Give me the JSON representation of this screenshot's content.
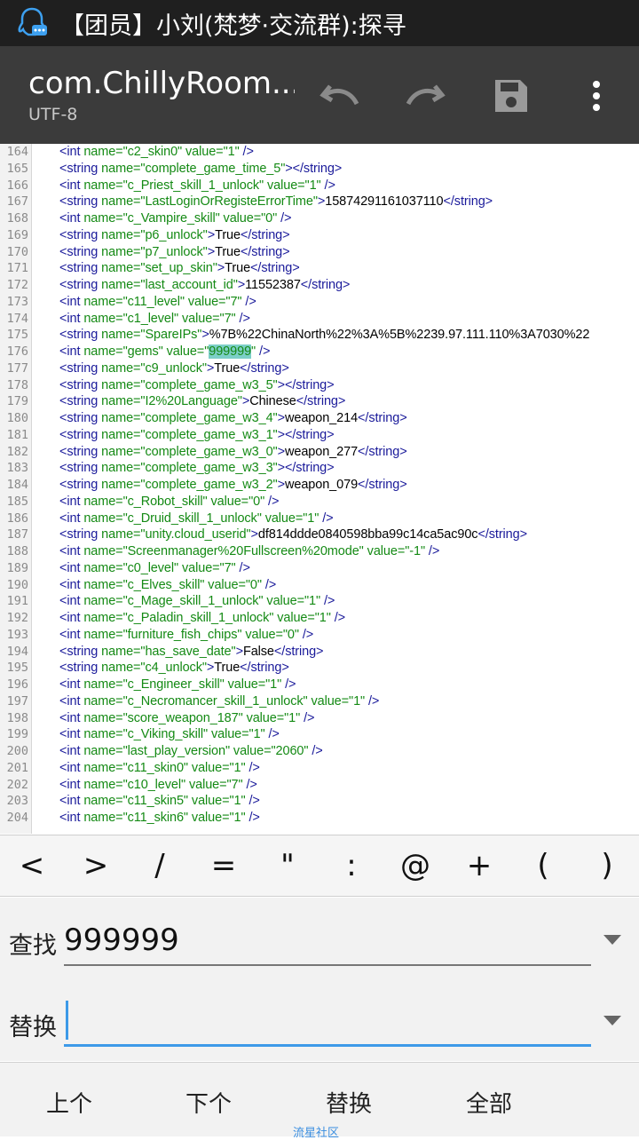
{
  "status_bar": {
    "notification": "【团员】小刘(梵梦·交流群):探寻",
    "app_icon": "qq-chat-icon"
  },
  "toolbar": {
    "title": "com.ChillyRoom....",
    "encoding": "UTF-8",
    "undo_icon": "undo-icon",
    "redo_icon": "redo-icon",
    "save_icon": "save-icon",
    "menu_icon": "more-vert-icon"
  },
  "editor": {
    "lines": [
      {
        "n": "164",
        "parts": [
          [
            "t",
            "<int "
          ],
          [
            "n",
            "name="
          ],
          [
            "v",
            "\"c2_skin0\""
          ],
          [
            "n",
            " value="
          ],
          [
            "v",
            "\"1\""
          ],
          [
            "t",
            " />"
          ]
        ]
      },
      {
        "n": "165",
        "parts": [
          [
            "t",
            "<string "
          ],
          [
            "n",
            "name="
          ],
          [
            "v",
            "\"complete_game_time_5\""
          ],
          [
            "t",
            "></string>"
          ]
        ]
      },
      {
        "n": "166",
        "parts": [
          [
            "t",
            "<int "
          ],
          [
            "n",
            "name="
          ],
          [
            "v",
            "\"c_Priest_skill_1_unlock\""
          ],
          [
            "n",
            " value="
          ],
          [
            "v",
            "\"1\""
          ],
          [
            "t",
            " />"
          ]
        ]
      },
      {
        "n": "167",
        "parts": [
          [
            "t",
            "<string "
          ],
          [
            "n",
            "name="
          ],
          [
            "v",
            "\"LastLoginOrRegisteErrorTime\""
          ],
          [
            "t",
            ">"
          ],
          [
            "x",
            "15874291161037110"
          ],
          [
            "t",
            "</string>"
          ]
        ]
      },
      {
        "n": "168",
        "parts": [
          [
            "t",
            "<int "
          ],
          [
            "n",
            "name="
          ],
          [
            "v",
            "\"c_Vampire_skill\""
          ],
          [
            "n",
            " value="
          ],
          [
            "v",
            "\"0\""
          ],
          [
            "t",
            " />"
          ]
        ]
      },
      {
        "n": "169",
        "parts": [
          [
            "t",
            "<string "
          ],
          [
            "n",
            "name="
          ],
          [
            "v",
            "\"p6_unlock\""
          ],
          [
            "t",
            ">"
          ],
          [
            "x",
            "True"
          ],
          [
            "t",
            "</string>"
          ]
        ]
      },
      {
        "n": "170",
        "parts": [
          [
            "t",
            "<string "
          ],
          [
            "n",
            "name="
          ],
          [
            "v",
            "\"p7_unlock\""
          ],
          [
            "t",
            ">"
          ],
          [
            "x",
            "True"
          ],
          [
            "t",
            "</string>"
          ]
        ]
      },
      {
        "n": "171",
        "parts": [
          [
            "t",
            "<string "
          ],
          [
            "n",
            "name="
          ],
          [
            "v",
            "\"set_up_skin\""
          ],
          [
            "t",
            ">"
          ],
          [
            "x",
            "True"
          ],
          [
            "t",
            "</string>"
          ]
        ]
      },
      {
        "n": "172",
        "parts": [
          [
            "t",
            "<string "
          ],
          [
            "n",
            "name="
          ],
          [
            "v",
            "\"last_account_id\""
          ],
          [
            "t",
            ">"
          ],
          [
            "x",
            "11552387"
          ],
          [
            "t",
            "</string>"
          ]
        ]
      },
      {
        "n": "173",
        "parts": [
          [
            "t",
            "<int "
          ],
          [
            "n",
            "name="
          ],
          [
            "v",
            "\"c11_level\""
          ],
          [
            "n",
            " value="
          ],
          [
            "v",
            "\"7\""
          ],
          [
            "t",
            " />"
          ]
        ]
      },
      {
        "n": "174",
        "parts": [
          [
            "t",
            "<int "
          ],
          [
            "n",
            "name="
          ],
          [
            "v",
            "\"c1_level\""
          ],
          [
            "n",
            " value="
          ],
          [
            "v",
            "\"7\""
          ],
          [
            "t",
            " />"
          ]
        ]
      },
      {
        "n": "175",
        "parts": [
          [
            "t",
            "<string "
          ],
          [
            "n",
            "name="
          ],
          [
            "v",
            "\"SpareIPs\""
          ],
          [
            "t",
            ">"
          ],
          [
            "x",
            "%7B%22ChinaNorth%22%3A%5B%2239.97.111.110%3A7030%22"
          ]
        ]
      },
      {
        "n": "176",
        "parts": [
          [
            "t",
            "<int "
          ],
          [
            "n",
            "name="
          ],
          [
            "v",
            "\"gems\""
          ],
          [
            "n",
            " value="
          ],
          [
            "v",
            "\""
          ],
          [
            "h",
            "999999"
          ],
          [
            "v",
            "\""
          ],
          [
            "t",
            " />"
          ]
        ]
      },
      {
        "n": "177",
        "parts": [
          [
            "t",
            "<string "
          ],
          [
            "n",
            "name="
          ],
          [
            "v",
            "\"c9_unlock\""
          ],
          [
            "t",
            ">"
          ],
          [
            "x",
            "True"
          ],
          [
            "t",
            "</string>"
          ]
        ]
      },
      {
        "n": "178",
        "parts": [
          [
            "t",
            "<string "
          ],
          [
            "n",
            "name="
          ],
          [
            "v",
            "\"complete_game_w3_5\""
          ],
          [
            "t",
            "></string>"
          ]
        ]
      },
      {
        "n": "179",
        "parts": [
          [
            "t",
            "<string "
          ],
          [
            "n",
            "name="
          ],
          [
            "v",
            "\"I2%20Language\""
          ],
          [
            "t",
            ">"
          ],
          [
            "x",
            "Chinese"
          ],
          [
            "t",
            "</string>"
          ]
        ]
      },
      {
        "n": "180",
        "parts": [
          [
            "t",
            "<string "
          ],
          [
            "n",
            "name="
          ],
          [
            "v",
            "\"complete_game_w3_4\""
          ],
          [
            "t",
            ">"
          ],
          [
            "x",
            "weapon_214"
          ],
          [
            "t",
            "</string>"
          ]
        ]
      },
      {
        "n": "181",
        "parts": [
          [
            "t",
            "<string "
          ],
          [
            "n",
            "name="
          ],
          [
            "v",
            "\"complete_game_w3_1\""
          ],
          [
            "t",
            "></string>"
          ]
        ]
      },
      {
        "n": "182",
        "parts": [
          [
            "t",
            "<string "
          ],
          [
            "n",
            "name="
          ],
          [
            "v",
            "\"complete_game_w3_0\""
          ],
          [
            "t",
            ">"
          ],
          [
            "x",
            "weapon_277"
          ],
          [
            "t",
            "</string>"
          ]
        ]
      },
      {
        "n": "183",
        "parts": [
          [
            "t",
            "<string "
          ],
          [
            "n",
            "name="
          ],
          [
            "v",
            "\"complete_game_w3_3\""
          ],
          [
            "t",
            "></string>"
          ]
        ]
      },
      {
        "n": "184",
        "parts": [
          [
            "t",
            "<string "
          ],
          [
            "n",
            "name="
          ],
          [
            "v",
            "\"complete_game_w3_2\""
          ],
          [
            "t",
            ">"
          ],
          [
            "x",
            "weapon_079"
          ],
          [
            "t",
            "</string>"
          ]
        ]
      },
      {
        "n": "185",
        "parts": [
          [
            "t",
            "<int "
          ],
          [
            "n",
            "name="
          ],
          [
            "v",
            "\"c_Robot_skill\""
          ],
          [
            "n",
            " value="
          ],
          [
            "v",
            "\"0\""
          ],
          [
            "t",
            " />"
          ]
        ]
      },
      {
        "n": "186",
        "parts": [
          [
            "t",
            "<int "
          ],
          [
            "n",
            "name="
          ],
          [
            "v",
            "\"c_Druid_skill_1_unlock\""
          ],
          [
            "n",
            " value="
          ],
          [
            "v",
            "\"1\""
          ],
          [
            "t",
            " />"
          ]
        ]
      },
      {
        "n": "187",
        "parts": [
          [
            "t",
            "<string "
          ],
          [
            "n",
            "name="
          ],
          [
            "v",
            "\"unity.cloud_userid\""
          ],
          [
            "t",
            ">"
          ],
          [
            "x",
            "df814ddde0840598bba99c14ca5ac90c"
          ],
          [
            "t",
            "</string>"
          ]
        ]
      },
      {
        "n": "188",
        "parts": [
          [
            "t",
            "<int "
          ],
          [
            "n",
            "name="
          ],
          [
            "v",
            "\"Screenmanager%20Fullscreen%20mode\""
          ],
          [
            "n",
            " value="
          ],
          [
            "v",
            "\"-1\""
          ],
          [
            "t",
            " />"
          ]
        ]
      },
      {
        "n": "189",
        "parts": [
          [
            "t",
            "<int "
          ],
          [
            "n",
            "name="
          ],
          [
            "v",
            "\"c0_level\""
          ],
          [
            "n",
            " value="
          ],
          [
            "v",
            "\"7\""
          ],
          [
            "t",
            " />"
          ]
        ]
      },
      {
        "n": "190",
        "parts": [
          [
            "t",
            "<int "
          ],
          [
            "n",
            "name="
          ],
          [
            "v",
            "\"c_Elves_skill\""
          ],
          [
            "n",
            " value="
          ],
          [
            "v",
            "\"0\""
          ],
          [
            "t",
            " />"
          ]
        ]
      },
      {
        "n": "191",
        "parts": [
          [
            "t",
            "<int "
          ],
          [
            "n",
            "name="
          ],
          [
            "v",
            "\"c_Mage_skill_1_unlock\""
          ],
          [
            "n",
            " value="
          ],
          [
            "v",
            "\"1\""
          ],
          [
            "t",
            " />"
          ]
        ]
      },
      {
        "n": "192",
        "parts": [
          [
            "t",
            "<int "
          ],
          [
            "n",
            "name="
          ],
          [
            "v",
            "\"c_Paladin_skill_1_unlock\""
          ],
          [
            "n",
            " value="
          ],
          [
            "v",
            "\"1\""
          ],
          [
            "t",
            " />"
          ]
        ]
      },
      {
        "n": "193",
        "parts": [
          [
            "t",
            "<int "
          ],
          [
            "n",
            "name="
          ],
          [
            "v",
            "\"furniture_fish_chips\""
          ],
          [
            "n",
            " value="
          ],
          [
            "v",
            "\"0\""
          ],
          [
            "t",
            " />"
          ]
        ]
      },
      {
        "n": "194",
        "parts": [
          [
            "t",
            "<string "
          ],
          [
            "n",
            "name="
          ],
          [
            "v",
            "\"has_save_date\""
          ],
          [
            "t",
            ">"
          ],
          [
            "x",
            "False"
          ],
          [
            "t",
            "</string>"
          ]
        ]
      },
      {
        "n": "195",
        "parts": [
          [
            "t",
            "<string "
          ],
          [
            "n",
            "name="
          ],
          [
            "v",
            "\"c4_unlock\""
          ],
          [
            "t",
            ">"
          ],
          [
            "x",
            "True"
          ],
          [
            "t",
            "</string>"
          ]
        ]
      },
      {
        "n": "196",
        "parts": [
          [
            "t",
            "<int "
          ],
          [
            "n",
            "name="
          ],
          [
            "v",
            "\"c_Engineer_skill\""
          ],
          [
            "n",
            " value="
          ],
          [
            "v",
            "\"1\""
          ],
          [
            "t",
            " />"
          ]
        ]
      },
      {
        "n": "197",
        "parts": [
          [
            "t",
            "<int "
          ],
          [
            "n",
            "name="
          ],
          [
            "v",
            "\"c_Necromancer_skill_1_unlock\""
          ],
          [
            "n",
            " value="
          ],
          [
            "v",
            "\"1\""
          ],
          [
            "t",
            " />"
          ]
        ]
      },
      {
        "n": "198",
        "parts": [
          [
            "t",
            "<int "
          ],
          [
            "n",
            "name="
          ],
          [
            "v",
            "\"score_weapon_187\""
          ],
          [
            "n",
            " value="
          ],
          [
            "v",
            "\"1\""
          ],
          [
            "t",
            " />"
          ]
        ]
      },
      {
        "n": "199",
        "parts": [
          [
            "t",
            "<int "
          ],
          [
            "n",
            "name="
          ],
          [
            "v",
            "\"c_Viking_skill\""
          ],
          [
            "n",
            " value="
          ],
          [
            "v",
            "\"1\""
          ],
          [
            "t",
            " />"
          ]
        ]
      },
      {
        "n": "200",
        "parts": [
          [
            "t",
            "<int "
          ],
          [
            "n",
            "name="
          ],
          [
            "v",
            "\"last_play_version\""
          ],
          [
            "n",
            " value="
          ],
          [
            "v",
            "\"2060\""
          ],
          [
            "t",
            " />"
          ]
        ]
      },
      {
        "n": "201",
        "parts": [
          [
            "t",
            "<int "
          ],
          [
            "n",
            "name="
          ],
          [
            "v",
            "\"c11_skin0\""
          ],
          [
            "n",
            " value="
          ],
          [
            "v",
            "\"1\""
          ],
          [
            "t",
            " />"
          ]
        ]
      },
      {
        "n": "202",
        "parts": [
          [
            "t",
            "<int "
          ],
          [
            "n",
            "name="
          ],
          [
            "v",
            "\"c10_level\""
          ],
          [
            "n",
            " value="
          ],
          [
            "v",
            "\"7\""
          ],
          [
            "t",
            " />"
          ]
        ]
      },
      {
        "n": "203",
        "parts": [
          [
            "t",
            "<int "
          ],
          [
            "n",
            "name="
          ],
          [
            "v",
            "\"c11_skin5\""
          ],
          [
            "n",
            " value="
          ],
          [
            "v",
            "\"1\""
          ],
          [
            "t",
            " />"
          ]
        ]
      },
      {
        "n": "204",
        "parts": [
          [
            "t",
            "<int "
          ],
          [
            "n",
            "name="
          ],
          [
            "v",
            "\"c11_skin6\""
          ],
          [
            "n",
            " value="
          ],
          [
            "v",
            "\"1\""
          ],
          [
            "t",
            " />"
          ]
        ]
      }
    ]
  },
  "symbol_bar": {
    "symbols": [
      "<",
      ">",
      "/",
      "=",
      "\"",
      ":",
      "@",
      "+",
      "(",
      ")"
    ]
  },
  "find_panel": {
    "find_label": "查找",
    "find_value": "999999",
    "replace_label": "替换",
    "replace_value": ""
  },
  "bottom_bar": {
    "prev": "上个",
    "next": "下个",
    "replace": "替换",
    "all": "全部",
    "watermark": "流星社区"
  },
  "colors": {
    "tag": "#1a1a9a",
    "attr": "#148a14",
    "highlight": "#7ccfc7",
    "accent": "#3d9ae8"
  }
}
